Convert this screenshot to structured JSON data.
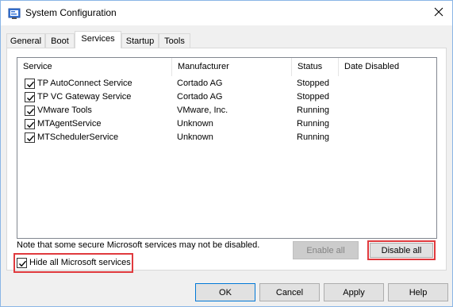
{
  "window": {
    "title": "System Configuration",
    "app_icon": "msconfig-icon",
    "close_icon": "close-icon"
  },
  "tabs": [
    {
      "label": "General",
      "active": false
    },
    {
      "label": "Boot",
      "active": false
    },
    {
      "label": "Services",
      "active": true
    },
    {
      "label": "Startup",
      "active": false
    },
    {
      "label": "Tools",
      "active": false
    }
  ],
  "services_table": {
    "columns": [
      "Service",
      "Manufacturer",
      "Status",
      "Date Disabled"
    ],
    "rows": [
      {
        "checked": true,
        "service": "TP AutoConnect Service",
        "manufacturer": "Cortado AG",
        "status": "Stopped",
        "date_disabled": ""
      },
      {
        "checked": true,
        "service": "TP VC Gateway Service",
        "manufacturer": "Cortado AG",
        "status": "Stopped",
        "date_disabled": ""
      },
      {
        "checked": true,
        "service": "VMware Tools",
        "manufacturer": "VMware, Inc.",
        "status": "Running",
        "date_disabled": ""
      },
      {
        "checked": true,
        "service": "MTAgentService",
        "manufacturer": "Unknown",
        "status": "Running",
        "date_disabled": ""
      },
      {
        "checked": true,
        "service": "MTSchedulerService",
        "manufacturer": "Unknown",
        "status": "Running",
        "date_disabled": ""
      }
    ]
  },
  "note": "Note that some secure Microsoft services may not be disabled.",
  "enable_all_label": "Enable all",
  "disable_all_label": "Disable all",
  "hide_ms": {
    "label": "Hide all Microsoft services",
    "checked": true
  },
  "buttons": {
    "ok": "OK",
    "cancel": "Cancel",
    "apply": "Apply",
    "help": "Help"
  },
  "colors": {
    "highlight": "#e03a3e",
    "accent_border": "#8ab6e6"
  }
}
